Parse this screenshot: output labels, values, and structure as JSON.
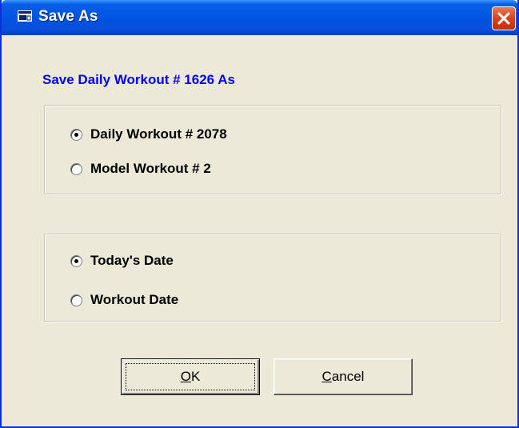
{
  "window": {
    "title": "Save As",
    "icon": "window-app-icon",
    "close_icon": "close-x-icon"
  },
  "heading": "Save Daily Workout  # 1626  As",
  "workout_group": {
    "options": [
      {
        "label": "Daily Workout # 2078",
        "checked": true
      },
      {
        "label": "Model Workout # 2",
        "checked": false
      }
    ]
  },
  "date_group": {
    "options": [
      {
        "label": "Today's Date",
        "checked": true
      },
      {
        "label": "Workout Date",
        "checked": false
      }
    ]
  },
  "buttons": {
    "ok_label": "OK",
    "ok_accel": "O",
    "ok_rest": "K",
    "cancel_label": "Cancel",
    "cancel_accel": "C",
    "cancel_rest": "ancel"
  },
  "colors": {
    "title_bar": "#0054e3",
    "heading_text": "#0000ff",
    "close_button": "#d9431d",
    "dialog_bg": "#ece9d8"
  }
}
